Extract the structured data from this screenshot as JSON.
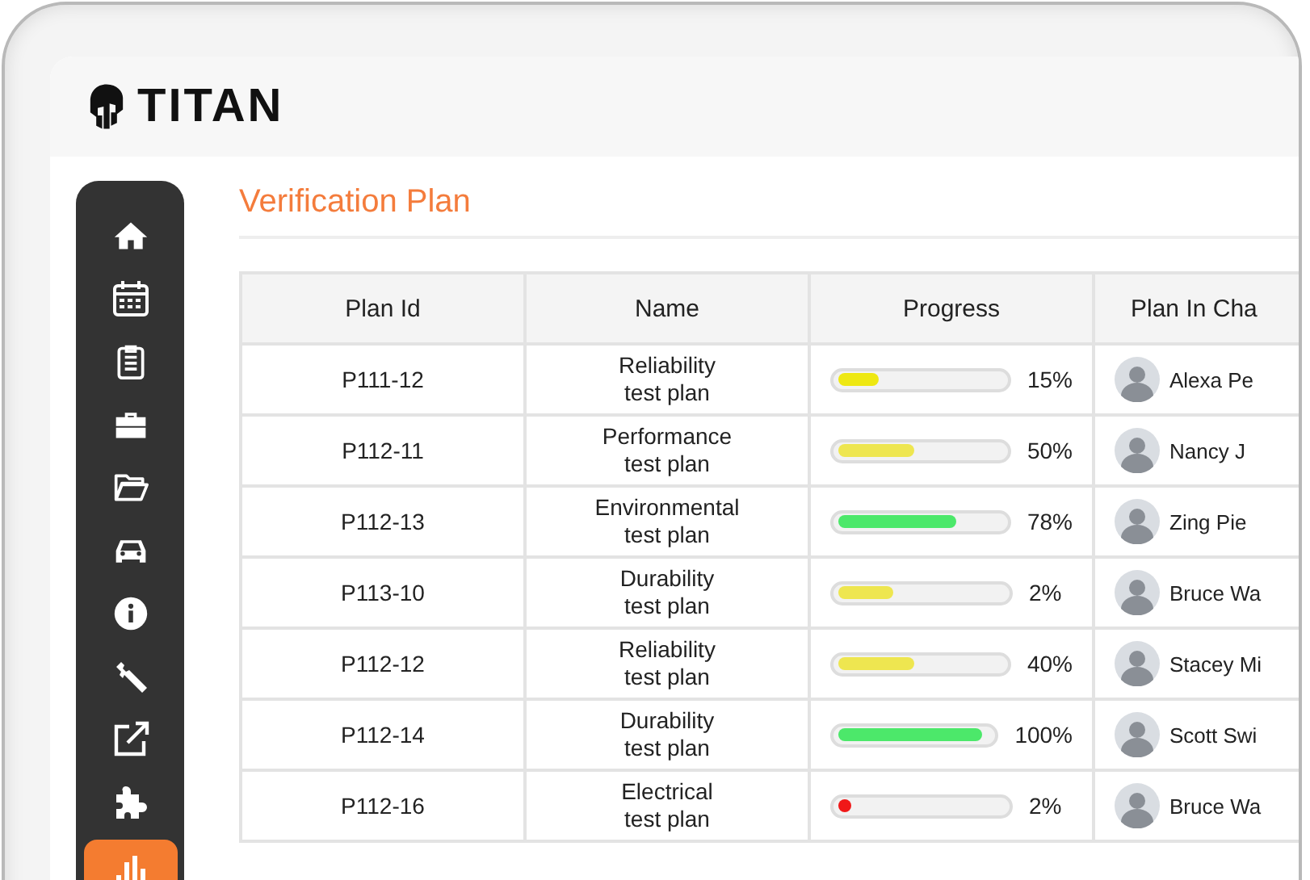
{
  "app": {
    "logo_text": "TITAN"
  },
  "sidebar": {
    "items": [
      {
        "kind": "home",
        "selected": false
      },
      {
        "kind": "calendar",
        "selected": false
      },
      {
        "kind": "clipboard",
        "selected": false
      },
      {
        "kind": "briefcase",
        "selected": false
      },
      {
        "kind": "folder",
        "selected": false
      },
      {
        "kind": "car",
        "selected": false
      },
      {
        "kind": "info",
        "selected": false
      },
      {
        "kind": "wrench",
        "selected": false
      },
      {
        "kind": "external",
        "selected": false
      },
      {
        "kind": "puzzle",
        "selected": false
      },
      {
        "kind": "chart",
        "selected": true
      }
    ]
  },
  "page_title": "Verification Plan",
  "table": {
    "columns": [
      "Plan Id",
      "Name",
      "Progress",
      "Plan In Cha"
    ],
    "rows": [
      {
        "plan_id": "P111-12",
        "name": [
          "Reliability",
          "test plan"
        ],
        "progress": {
          "level": 0.25,
          "color": "#eee812",
          "reading": "15%"
        },
        "owner": "Alexa Pe"
      },
      {
        "plan_id": "P112-11",
        "name": [
          "Performance",
          "test plan"
        ],
        "progress": {
          "level": 0.46,
          "color": "#eee650",
          "reading": "50%"
        },
        "owner": "Nancy J"
      },
      {
        "plan_id": "P112-13",
        "name": [
          "Environmental",
          "test plan"
        ],
        "progress": {
          "level": 0.72,
          "color": "#4ce86a",
          "reading": "78%"
        },
        "owner": "Zing Pie"
      },
      {
        "plan_id": "P113-10",
        "name": [
          "Durability",
          "test plan"
        ],
        "progress": {
          "level": 0.33,
          "color": "#eee650",
          "reading": "2%"
        },
        "owner": "Bruce Wa"
      },
      {
        "plan_id": "P112-12",
        "name": [
          "Reliability",
          "test plan"
        ],
        "progress": {
          "level": 0.46,
          "color": "#eee650",
          "reading": "40%"
        },
        "owner": "Stacey Mi"
      },
      {
        "plan_id": "P112-14",
        "name": [
          "Durability",
          "test plan"
        ],
        "progress": {
          "level": 0.95,
          "color": "#4ce86a",
          "reading": "100%"
        },
        "owner": "Scott Swi"
      },
      {
        "plan_id": "P112-16",
        "name": [
          "Electrical",
          "test plan"
        ],
        "progress": {
          "level": 0.06,
          "color": "#f01818",
          "reading": "2%"
        },
        "owner": "Bruce Wa"
      }
    ]
  }
}
